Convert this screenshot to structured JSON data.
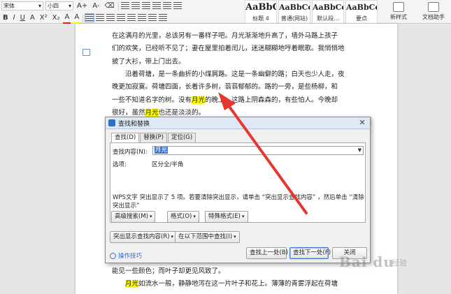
{
  "ribbon": {
    "font_name": "宋体",
    "font_size": "小四",
    "row1_buttons": [
      "A+",
      "A-",
      "⌫"
    ],
    "row2_buttons": [
      "B",
      "I",
      "U",
      "A",
      "X²",
      "X₂",
      "A",
      "A"
    ],
    "styles": [
      {
        "preview": "AaBbC",
        "name": "标题 4"
      },
      {
        "preview": "AaBbCcDd",
        "name": "普通(网站)"
      },
      {
        "preview": "AaBbCcDd",
        "name": "默认段..."
      },
      {
        "preview": "AaBbCcDd",
        "name": "要点"
      }
    ],
    "new_style": "新样式",
    "wen_zhushou": "文档助手"
  },
  "document": {
    "lines": [
      {
        "parts": [
          {
            "t": "在这满月的光里，总该另有一番样子吧。月光渐渐地升高了，墙外马路上孩子"
          }
        ]
      },
      {
        "parts": [
          {
            "t": "们的欢笑，已经听不见了；妻在屋里拍着闰儿，迷迷糊糊地哼着眠歌。我悄悄地"
          }
        ]
      },
      {
        "parts": [
          {
            "t": "披了大衫，带上门出去。"
          }
        ]
      },
      {
        "parts": [
          {
            "t": "　　沿着荷塘，是一条曲折的小煤屑路。这是一条幽僻的路；白天也少人走，夜"
          }
        ]
      },
      {
        "parts": [
          {
            "t": "晚更加寂寞。荷塘四面，长着许多树，蓊蓊郁郁的。路的一旁，是些杨柳，和"
          }
        ]
      },
      {
        "parts": [
          {
            "t": "一些不知道名字的树。没有"
          },
          {
            "t": "月光",
            "hl": true
          },
          {
            "t": "的晚上，这路上阴森森的，有些怕人。今晚却"
          }
        ]
      },
      {
        "parts": [
          {
            "t": "很好，虽然"
          },
          {
            "t": "月光",
            "hl": true
          },
          {
            "t": "也还是淡淡的。"
          }
        ]
      }
    ],
    "bottom_lines": [
      {
        "parts": [
          {
            "t": "能见一些颜色；而叶子却更见风致了。"
          }
        ]
      },
      {
        "parts": [
          {
            "t": "　　"
          },
          {
            "t": "月光",
            "hl": true
          },
          {
            "t": "如流水一般，静静地泻在这一片叶子和花上。薄薄的青雾浮起在荷塘"
          }
        ]
      }
    ]
  },
  "dialog": {
    "title": "查找和替换",
    "close": "✕",
    "tabs": [
      "查找(D)",
      "替换(P)",
      "定位(G)"
    ],
    "find_label": "查找内容(N):",
    "find_value": "月光",
    "options_label": "选项:",
    "options_value": "区分全/半角",
    "message": "WPS文字 突出显示了 5 项。若要清除突出显示，请单击 “突出显示查找内容” ，然后单击 “清除突出显示”",
    "buttons": {
      "advanced": "高级搜索(M)",
      "format": "格式(O)",
      "special": "特殊格式(E)",
      "highlight": "突出显示查找内容(R)",
      "find_in": "在以下范围中查找(I)",
      "find_prev": "查找上一处(B)",
      "find_next": "查找下一处(F)",
      "close": "关闭"
    },
    "tip": "操作技巧"
  },
  "watermark": {
    "main": "Bai du",
    "sub": "经验"
  }
}
